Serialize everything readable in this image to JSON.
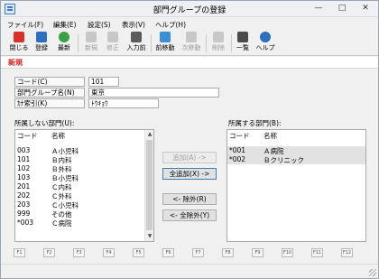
{
  "window": {
    "title": "部門グループの登録"
  },
  "menu": [
    "ファイル(F)",
    "編集(E)",
    "設定(S)",
    "表示(V)",
    "ヘルプ(H)"
  ],
  "toolbar": [
    {
      "label": "閉じる",
      "icon": "close-icon",
      "color": "#d9302c",
      "enabled": true
    },
    {
      "label": "登録",
      "icon": "save-icon",
      "color": "#2d6fbd",
      "enabled": true
    },
    {
      "label": "最新",
      "icon": "refresh-icon",
      "color": "#3aa142",
      "enabled": true
    },
    {
      "label": "新規",
      "icon": "new-icon",
      "color": "#c8c8c8",
      "enabled": false
    },
    {
      "label": "修正",
      "icon": "edit-icon",
      "color": "#c8c8c8",
      "enabled": false
    },
    {
      "label": "入力前",
      "icon": "undo-icon",
      "color": "#5b5b5b",
      "enabled": true
    },
    {
      "label": "前移動",
      "icon": "up-arrow-icon",
      "color": "#3b8fd6",
      "enabled": true
    },
    {
      "label": "次移動",
      "icon": "down-arrow-icon",
      "color": "#c8c8c8",
      "enabled": false
    },
    {
      "label": "削除",
      "icon": "delete-icon",
      "color": "#c8c8c8",
      "enabled": false
    },
    {
      "label": "一覧",
      "icon": "list-icon",
      "color": "#4a4a4a",
      "enabled": true
    },
    {
      "label": "ヘルプ",
      "icon": "help-icon",
      "color": "#2d6fbd",
      "enabled": true
    }
  ],
  "mode": "新規",
  "form": {
    "code_label": "コード(C)",
    "code_value": "101",
    "name_label": "部門グループ名(N)",
    "name_value": "東京",
    "kana_label": "ｶﾅ索引(K)",
    "kana_value": "ﾄｳｷｮｳ"
  },
  "left_list": {
    "label": "所属しない部門(U):",
    "col_code": "コード",
    "col_name": "名称",
    "rows": [
      {
        "code": "003",
        "name": "Ａ小児科"
      },
      {
        "code": "101",
        "name": "Ｂ内科"
      },
      {
        "code": "102",
        "name": "Ｂ外科"
      },
      {
        "code": "103",
        "name": "Ｂ小児科"
      },
      {
        "code": "201",
        "name": "Ｃ内科"
      },
      {
        "code": "202",
        "name": "Ｃ外科"
      },
      {
        "code": "203",
        "name": "Ｃ小児科"
      },
      {
        "code": "999",
        "name": "その他"
      },
      {
        "code": "*003",
        "name": "Ｃ病院"
      }
    ]
  },
  "right_list": {
    "label": "所属する部門(B):",
    "col_code": "コード",
    "col_name": "名称",
    "rows": [
      {
        "code": "*001",
        "name": "Ａ病院"
      },
      {
        "code": "*002",
        "name": "Ｂクリニック"
      }
    ]
  },
  "buttons": {
    "add": "追加(A) ->",
    "add_all": "全追加(X) ->",
    "remove": "<- 除外(R)",
    "remove_all": "<- 全除外(Y)"
  },
  "fkeys": [
    "F1",
    "F2",
    "F3",
    "F4",
    "F5",
    "F6",
    "F7",
    "F8",
    "F9",
    "F10",
    "F11",
    "F12"
  ]
}
